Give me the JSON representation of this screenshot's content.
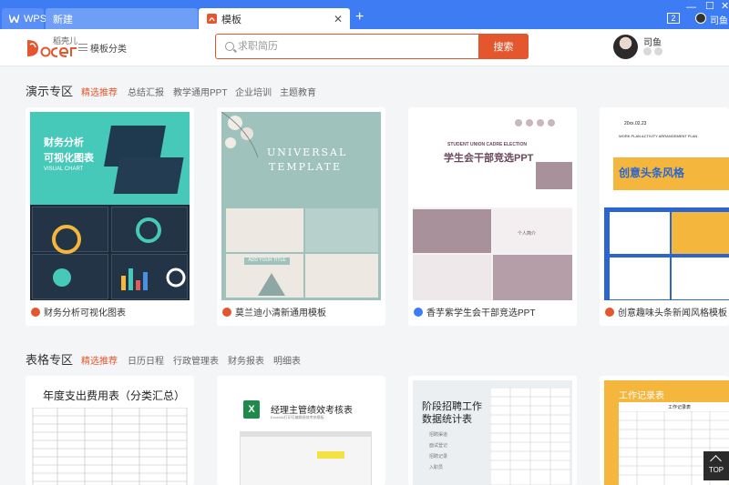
{
  "tabs": {
    "wps": "WPS",
    "new": "新建",
    "active": "模板",
    "add": "+"
  },
  "window": {
    "notif_count": "2",
    "user": "司鱼"
  },
  "header": {
    "logo_text": "Docer",
    "logo_sub": "稻壳儿",
    "menu_label": "模板分类",
    "search_placeholder": "求职简历",
    "search_button": "搜索",
    "username": "司鱼"
  },
  "present": {
    "title": "演示专区",
    "filters": [
      "精选推荐",
      "总结汇报",
      "教学通用PPT",
      "企业培训",
      "主题教育"
    ],
    "cards": [
      {
        "label": "财务分析可视化图表",
        "thumb_title": "财务分析",
        "thumb_title2": "可视化图表",
        "thumb_sub": "VISUAL CHART"
      },
      {
        "label": "莫兰迪小清新通用模板",
        "thumb_title": "UNIVERSAL",
        "thumb_title2": "TEMPLATE",
        "thumb_sub": "ADD YOUR TITLE"
      },
      {
        "label": "香芋紫学生会干部竞选PPT",
        "thumb_title": "STUDENT UNION CADRE ELECTION",
        "thumb_title2": "学生会干部竞选PPT",
        "thumb_sub": "个人简介"
      },
      {
        "label": "创意趣味头条新闻风格模板",
        "thumb_title": "WORK PLAN ACTIVITY ARRANGEMENT PLAN",
        "thumb_title2": "创意头条风格",
        "thumb_sub": "20xx.02.23"
      }
    ]
  },
  "sheets": {
    "title": "表格专区",
    "filters": [
      "精选推荐",
      "日历日程",
      "行政管理表",
      "财务报表",
      "明细表"
    ],
    "cards": [
      {
        "thumb_title": "年度支出费用表（分类汇总）"
      },
      {
        "thumb_title": "经理主管绩效考核表",
        "thumb_sub": "Excel4A打印可编辑绩效考核模板"
      },
      {
        "thumb_title": "阶段招聘工作",
        "thumb_title2": "数据统计表",
        "thumb_items": [
          "招聘渠道",
          "面试登记",
          "招聘记录",
          "入职员"
        ]
      },
      {
        "thumb_title": "工作记录表",
        "thumb_sub": "工作记录表"
      }
    ]
  },
  "top_button": "TOP",
  "colors": {
    "accent": "#e4572e",
    "tabbar": "#3d7cf2"
  }
}
